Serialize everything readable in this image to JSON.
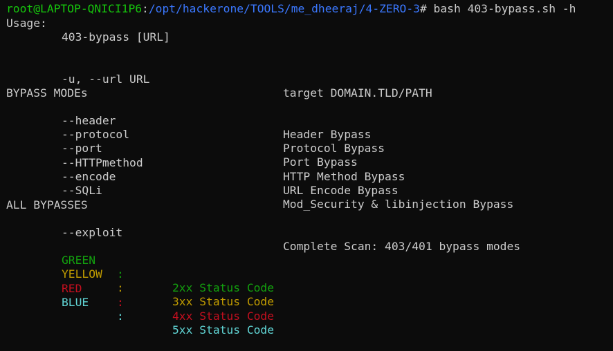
{
  "prompt": {
    "user_host": "root@LAPTOP-QNICI1P6",
    "colon": ":",
    "path": "/opt/hackerone/TOOLS/me_dheeraj/4-ZERO-3",
    "command": "# bash 403-bypass.sh -h"
  },
  "usage": {
    "heading": "Usage:",
    "syntax": "403-bypass [URL]",
    "option": "-u, --url URL",
    "option_desc": "target DOMAIN.TLD/PATH"
  },
  "bypass_modes": {
    "heading": "BYPASS MODEs",
    "items": [
      {
        "flag": "--header",
        "desc": "Header Bypass"
      },
      {
        "flag": "--protocol",
        "desc": "Protocol Bypass"
      },
      {
        "flag": "--port",
        "desc": "Port Bypass"
      },
      {
        "flag": "--HTTPmethod",
        "desc": "HTTP Method Bypass"
      },
      {
        "flag": "--encode",
        "desc": "URL Encode Bypass"
      },
      {
        "flag": "--SQLi",
        "desc": "Mod_Security & libinjection Bypass"
      }
    ]
  },
  "all_bypasses": {
    "heading": "ALL BYPASSES",
    "flag": "--exploit",
    "desc": "Complete Scan: 403/401 bypass modes"
  },
  "legend": [
    {
      "name": "GREEN",
      "colon": ":",
      "status": "2xx Status Code",
      "color": "#13a10e"
    },
    {
      "name": "YELLOW",
      "colon": ":",
      "status": "3xx Status Code",
      "color": "#c19c00"
    },
    {
      "name": "RED",
      "colon": ":",
      "status": "4xx Status Code",
      "color": "#c50f1f"
    },
    {
      "name": "BLUE",
      "colon": ":",
      "status": "5xx Status Code",
      "color": "#61d6d6"
    }
  ]
}
